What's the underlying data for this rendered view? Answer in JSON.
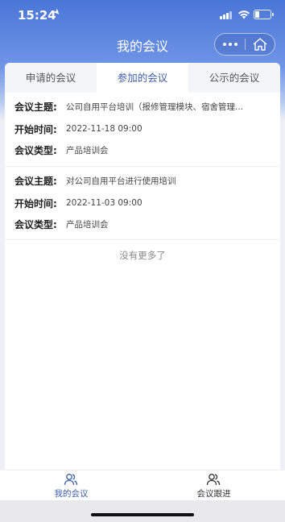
{
  "status_bar": {
    "time": "15:24"
  },
  "nav": {
    "title": "我的会议"
  },
  "tabs": [
    {
      "label": "申请的会议",
      "active": false
    },
    {
      "label": "参加的会议",
      "active": true
    },
    {
      "label": "公示的会议",
      "active": false
    }
  ],
  "labels": {
    "subject": "会议主题:",
    "start_time": "开始时间:",
    "type": "会议类型:"
  },
  "meetings": [
    {
      "subject": "公司自用平台培训（报修管理模块、宿舍管理...",
      "start_time": "2022-11-18 09:00",
      "type": "产品培训会"
    },
    {
      "subject": "对公司自用平台进行使用培训",
      "start_time": "2022-11-03 09:00",
      "type": "产品培训会"
    }
  ],
  "list_footer": "没有更多了",
  "tabbar": [
    {
      "label": "我的会议",
      "active": true,
      "icon": "users-icon"
    },
    {
      "label": "会议跟进",
      "active": false,
      "icon": "users-icon"
    }
  ],
  "colors": {
    "accent": "#3d5ea8",
    "header": "#4a76d8"
  }
}
